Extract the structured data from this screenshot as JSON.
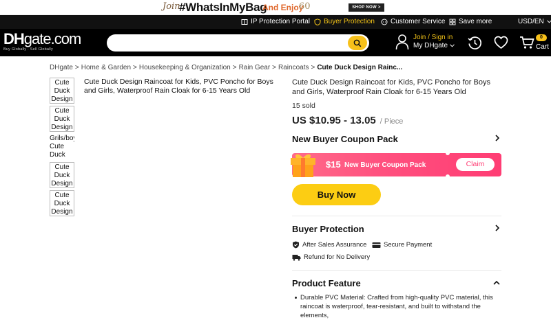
{
  "promo": {
    "join": "Join",
    "hashtag": "#WhatsInMyBag",
    "and_enjoy": "And Enjoy",
    "badge": "60",
    "shop_now": "SHOP NOW >"
  },
  "topbar": {
    "ip_protection": "IP Protection Portal",
    "buyer_protection": "Buyer Protection",
    "customer_service": "Customer Service",
    "save_more": "Save more",
    "locale": "USD/EN"
  },
  "header": {
    "logo_dh": "DH",
    "logo_gate": "gate.com",
    "logo_tagline": "Buy Globally · Sell Globally",
    "search_placeholder": "",
    "join_signin": "Join / Sign in",
    "my_dhgate": "My DHgate",
    "cart_count": "0",
    "cart_label": "Cart"
  },
  "breadcrumb": {
    "items": [
      "DHgate",
      "Home & Garden",
      "Housekeeping & Organization",
      "Rain Gear",
      "Raincoats"
    ],
    "current": "Cute Duck Design Rainc..."
  },
  "gallery": {
    "thumbs": [
      "Cute Duck Design",
      "Cute Duck Design",
      "Grils/boys Cute Duck",
      "Cute Duck Design",
      "Cute Duck Design"
    ],
    "main_alt": "Cute Duck Design Raincoat for Kids, PVC Poncho for Boys and Girls, Waterproof Rain Cloak for 6-15 Years Old"
  },
  "product": {
    "title": "Cute Duck Design Raincoat for Kids, PVC Poncho for Boys and Girls, Waterproof Rain Cloak for 6-15 Years Old",
    "sold": "15 sold",
    "price": "US $10.95 - 13.05",
    "per_unit": "/ Piece"
  },
  "coupon": {
    "heading": "New Buyer Coupon Pack",
    "amount": "$15",
    "text": "New Buyer Coupon Pack",
    "claim": "Claim"
  },
  "buy_now": "Buy Now",
  "buyer_protection": {
    "heading": "Buyer Protection",
    "after_sales": "After Sales Assurance",
    "secure_payment": "Secure Payment",
    "refund": "Refund for No Delivery"
  },
  "product_feature": {
    "heading": "Product Feature",
    "line1": "Durable PVC Material: Crafted from high-quality PVC material, this",
    "line2": "raincoat is waterproof, tear-resistant, and built to withstand the elements,"
  },
  "colors": {
    "accent_yellow": "#fccd13",
    "coupon_pink": "#ff4f7e",
    "header_black": "#000000"
  }
}
